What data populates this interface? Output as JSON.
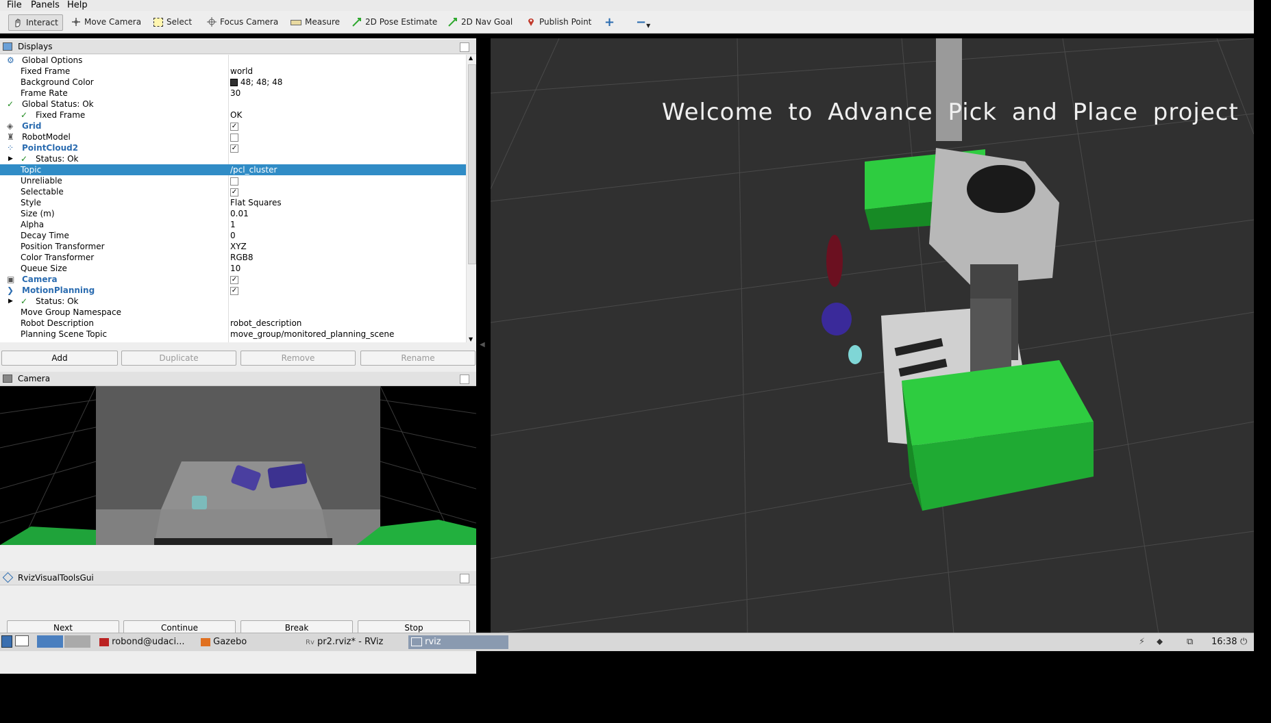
{
  "menu": [
    "File",
    "Panels",
    "Help"
  ],
  "toolbar": {
    "interact": "Interact",
    "move_camera": "Move Camera",
    "select": "Select",
    "focus_camera": "Focus Camera",
    "measure": "Measure",
    "pose_estimate": "2D Pose Estimate",
    "nav_goal": "2D Nav Goal",
    "publish_point": "Publish Point",
    "colors": {
      "pose": "#2fa82f",
      "nav": "#2fa82f",
      "point": "#c0392b"
    }
  },
  "displays": {
    "title": "Displays",
    "rows": {
      "global_options": "Global Options",
      "fixed_frame": "Fixed Frame",
      "fixed_frame_val": "world",
      "bg_color": "Background Color",
      "bg_color_val": "48; 48; 48",
      "frame_rate": "Frame Rate",
      "frame_rate_val": "30",
      "global_status": "Global Status: Ok",
      "ff_status": "Fixed Frame",
      "ff_status_val": "OK",
      "grid": "Grid",
      "robot_model": "RobotModel",
      "pointcloud2": "PointCloud2",
      "pc_status": "Status: Ok",
      "topic": "Topic",
      "topic_val": "/pcl_cluster",
      "unreliable": "Unreliable",
      "selectable": "Selectable",
      "style": "Style",
      "style_val": "Flat Squares",
      "size": "Size (m)",
      "size_val": "0.01",
      "alpha": "Alpha",
      "alpha_val": "1",
      "decay": "Decay Time",
      "decay_val": "0",
      "pos_tf": "Position Transformer",
      "pos_tf_val": "XYZ",
      "color_tf": "Color Transformer",
      "color_tf_val": "RGB8",
      "queue": "Queue Size",
      "queue_val": "10",
      "camera": "Camera",
      "motion_planning": "MotionPlanning",
      "mp_status": "Status: Ok",
      "mgn": "Move Group Namespace",
      "robot_desc": "Robot Description",
      "robot_desc_val": "robot_description",
      "planning_scene": "Planning Scene Topic",
      "planning_scene_val": "move_group/monitored_planning_scene"
    },
    "buttons": {
      "add": "Add",
      "duplicate": "Duplicate",
      "remove": "Remove",
      "rename": "Rename"
    }
  },
  "camera_panel": {
    "title": "Camera"
  },
  "rviz_tools": {
    "title": "RvizVisualToolsGui",
    "next": "Next",
    "continue": "Continue",
    "break": "Break",
    "stop": "Stop"
  },
  "view3d": {
    "welcome": "Welcome to Advance Pick and Place project",
    "bg": "#303030"
  },
  "taskbar": {
    "term": "robond@udaci...",
    "gazebo": "Gazebo",
    "rviz_window": "pr2.rviz* - RViz",
    "rviz": "rviz",
    "clock": "16:38"
  }
}
